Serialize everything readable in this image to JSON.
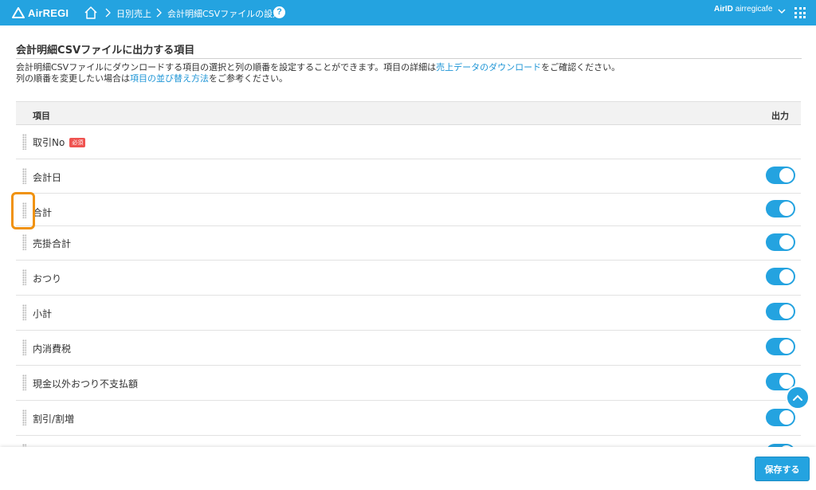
{
  "app": {
    "logo_text": "AirREGI"
  },
  "breadcrumb": {
    "items": [
      "日別売上",
      "会計明細CSVファイルの設定"
    ],
    "help_label": "?"
  },
  "account": {
    "prefix": "AirID",
    "name": "airregicafe"
  },
  "section": {
    "title": "会計明細CSVファイルに出力する項目",
    "desc_line1_a": "会計明細CSVファイルにダウンロードする項目の選択と列の順番を設定することができます。項目の詳細は",
    "desc_line1_link": "売上データのダウンロード",
    "desc_line1_b": "をご確認ください。",
    "desc_line2_a": "列の順番を変更したい場合は",
    "desc_line2_link": "項目の並び替え方法",
    "desc_line2_b": "をご参考ください。"
  },
  "table": {
    "col_item": "項目",
    "col_output": "出力",
    "rows": [
      {
        "label": "取引No",
        "badge": "必須",
        "output": null
      },
      {
        "label": "会計日",
        "output": true
      },
      {
        "label": "合計",
        "output": true
      },
      {
        "label": "売掛合計",
        "output": true
      },
      {
        "label": "おつり",
        "output": true
      },
      {
        "label": "小計",
        "output": true
      },
      {
        "label": "内消費税",
        "output": true
      },
      {
        "label": "現金以外おつり不支払額",
        "output": true
      },
      {
        "label": "割引/割増",
        "output": true
      }
    ]
  },
  "footer": {
    "save_label": "保存する"
  },
  "colors": {
    "primary": "#24a3e0",
    "badge": "#ef5350",
    "highlight": "#f0920f"
  }
}
